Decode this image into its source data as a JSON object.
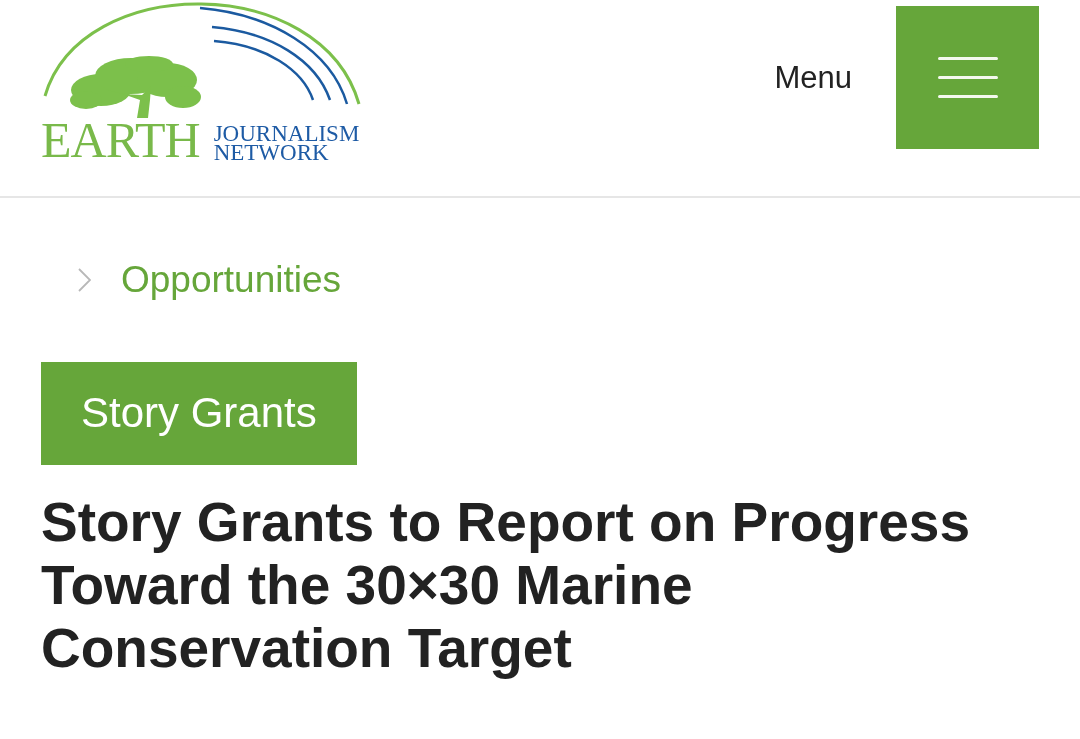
{
  "header": {
    "logo": {
      "wordmark": "EARTH",
      "line_1": "JOURNALISM",
      "line_2": "NETWORK"
    },
    "menu": {
      "label": "Menu"
    }
  },
  "breadcrumb": [
    {
      "label": "Opportunities"
    }
  ],
  "category_tag": "Story Grants",
  "title": "Story Grants to Report on Progress Toward the 30×30 Marine Conservation Target"
}
